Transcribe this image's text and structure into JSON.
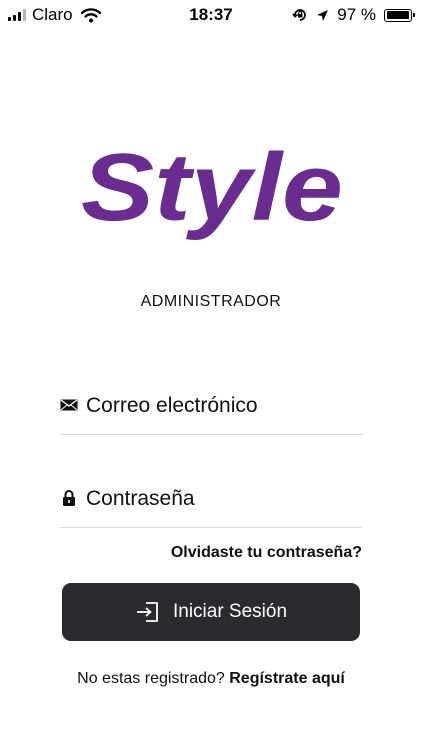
{
  "status_bar": {
    "carrier": "Claro",
    "time": "18:37",
    "battery": "97 %",
    "battery_level": 0.97,
    "icons": [
      "signal-icon",
      "wifi-icon",
      "rotation-lock-icon",
      "location-arrow-icon",
      "battery-icon"
    ]
  },
  "brand": {
    "logo_text": "Style",
    "logo_color": "#6a2c91",
    "subtitle": "ADMINISTRADOR"
  },
  "form": {
    "email_placeholder": "Correo electrónico",
    "email_icon": "envelope-icon",
    "password_placeholder": "Contraseña",
    "password_icon": "lock-icon",
    "forgot_label": "Olvidaste tu contraseña?",
    "submit_label": "Iniciar Sesión",
    "submit_icon": "sign-in-icon",
    "button_color": "#2b2b2d"
  },
  "footer": {
    "prompt": "No estas registrado?",
    "link_label": "Regístrate aquí"
  }
}
